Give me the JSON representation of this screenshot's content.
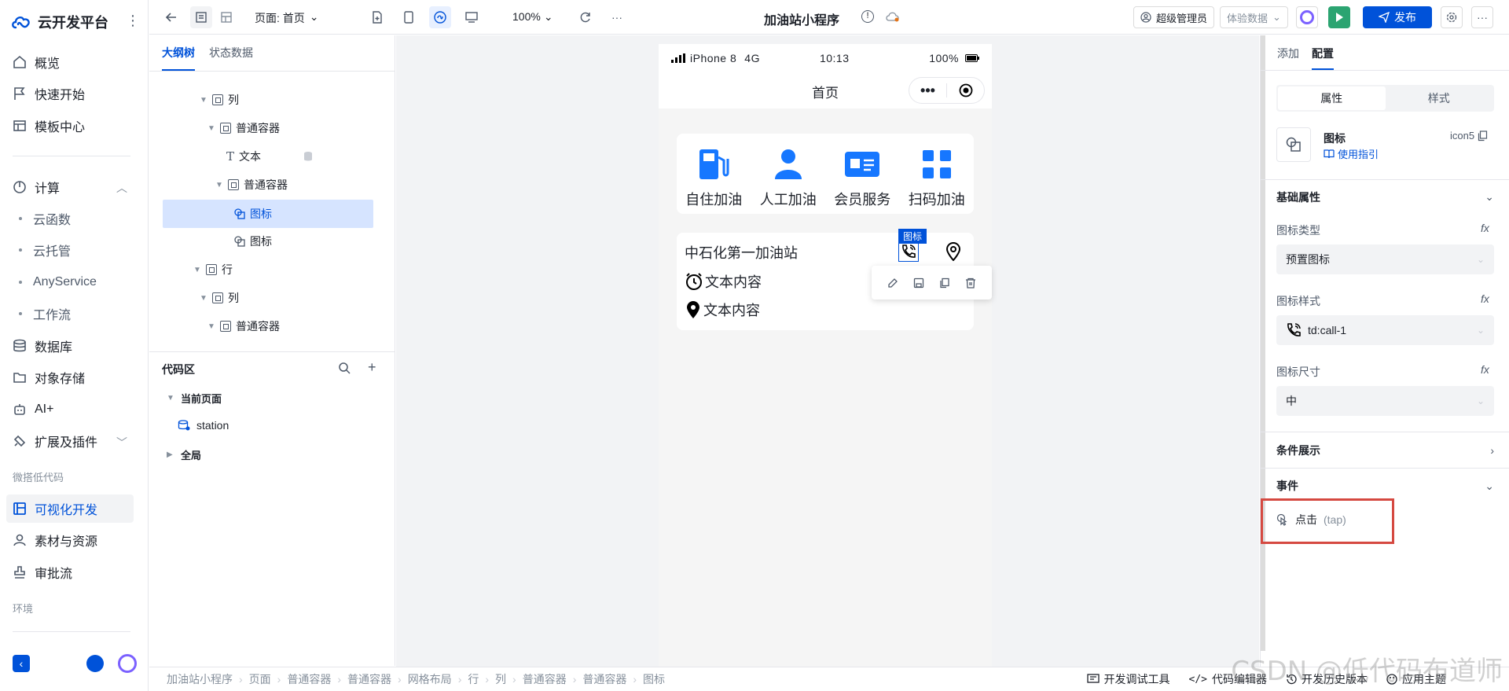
{
  "app": {
    "name": "云开发平台",
    "more": "⋮"
  },
  "leftnav": {
    "items": [
      {
        "label": "概览"
      },
      {
        "label": "快速开始"
      },
      {
        "label": "模板中心"
      }
    ],
    "compute": {
      "label": "计算",
      "subs": [
        "云函数",
        "云托管",
        "AnyService",
        "工作流"
      ]
    },
    "items2": [
      {
        "label": "数据库"
      },
      {
        "label": "对象存储"
      },
      {
        "label": "AI+"
      },
      {
        "label": "扩展及插件"
      }
    ],
    "group_lowcode": "微搭低代码",
    "items3": [
      {
        "label": "可视化开发"
      },
      {
        "label": "素材与资源"
      },
      {
        "label": "审批流"
      }
    ],
    "group_env": "环境"
  },
  "topbar": {
    "page_label": "页面: 首页",
    "zoom": "100%",
    "app_title": "加油站小程序",
    "admin_label": "超级管理员",
    "data_mode": "体验数据",
    "publish_label": "发布",
    "more": "···"
  },
  "outline": {
    "tabs": [
      "大纲树",
      "状态数据"
    ],
    "rows": [
      {
        "label": "列"
      },
      {
        "label": "普通容器"
      },
      {
        "label": "文本"
      },
      {
        "label": "普通容器"
      },
      {
        "label": "图标"
      },
      {
        "label": "图标"
      },
      {
        "label": "行"
      },
      {
        "label": "列"
      },
      {
        "label": "普通容器"
      }
    ]
  },
  "code": {
    "title": "代码区",
    "current_page": "当前页面",
    "item": "station",
    "global": "全局"
  },
  "phone": {
    "device": "iPhone 8",
    "network": "4G",
    "time": "10:13",
    "battery": "100%",
    "page_title": "首页",
    "functions": [
      "自住加油",
      "人工加油",
      "会员服务",
      "扫码加油"
    ],
    "station_name": "中石化第一加油站",
    "line1": "文本内容",
    "line2": "文本内容",
    "selected_tag": "图标"
  },
  "right": {
    "tabs": [
      "添加",
      "配置"
    ],
    "seg": [
      "属性",
      "样式"
    ],
    "component_name": "图标",
    "component_id": "icon5",
    "guide": "使用指引",
    "basic_section": "基础属性",
    "icon_type_label": "图标类型",
    "icon_type_value": "预置图标",
    "icon_style_label": "图标样式",
    "icon_style_value": "td:call-1",
    "icon_size_label": "图标尺寸",
    "icon_size_value": "中",
    "fx": "fx",
    "cond_section": "条件展示",
    "event_section": "事件",
    "event_item": "点击",
    "event_item_sub": "(tap)"
  },
  "footer": {
    "crumbs": [
      "加油站小程序",
      "页面",
      "普通容器",
      "普通容器",
      "网格布局",
      "行",
      "列",
      "普通容器",
      "普通容器",
      "图标"
    ],
    "tools": [
      "开发调试工具",
      "代码编辑器",
      "开发历史版本",
      "应用主题"
    ]
  },
  "watermark": "CSDN @低代码布道师",
  "colors": {
    "primary": "#0052d9",
    "publish": "#0052d9",
    "run": "#2ba471",
    "highlight_box": "#d54941"
  }
}
